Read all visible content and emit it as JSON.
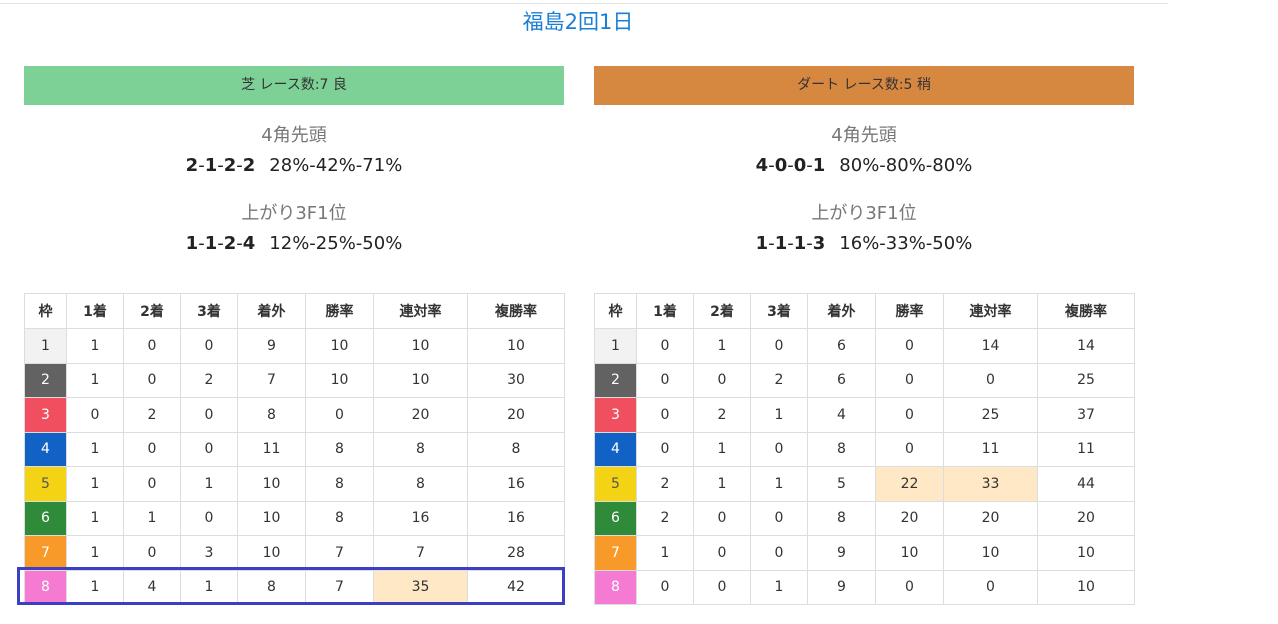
{
  "page": {
    "title": "福島2回1日"
  },
  "colors": {
    "link": "#1a7fd4",
    "turf_banner": "#7dd197",
    "dirt_banner": "#d68841",
    "highlight_cell": "#ffe8c6",
    "selection_box": "#3b3fc4",
    "waku": [
      {
        "bg": "#f2f2f2",
        "fg": "#333333"
      },
      {
        "bg": "#626262",
        "fg": "#ffffff"
      },
      {
        "bg": "#ef4f5e",
        "fg": "#ffffff"
      },
      {
        "bg": "#1262c6",
        "fg": "#ffffff"
      },
      {
        "bg": "#f4d214",
        "fg": "#555555"
      },
      {
        "bg": "#2f8a3a",
        "fg": "#ffffff"
      },
      {
        "bg": "#f89a2a",
        "fg": "#ffffff"
      },
      {
        "bg": "#f57ad2",
        "fg": "#ffffff"
      }
    ]
  },
  "headers": [
    "枠",
    "1着",
    "2着",
    "3着",
    "着外",
    "勝率",
    "連対率",
    "複勝率"
  ],
  "panels": [
    {
      "banner": "芝 レース数:7 良",
      "banner_color": "#7dd197",
      "corner_title": "4角先頭",
      "corner_record": [
        "2",
        "1",
        "2",
        "2"
      ],
      "corner_pct": "28%-42%-71%",
      "agari_title": "上がり3F1位",
      "agari_record": [
        "1",
        "1",
        "2",
        "4"
      ],
      "agari_pct": "12%-25%-50%",
      "rows": [
        [
          "1",
          "1",
          "0",
          "0",
          "9",
          "10",
          "10",
          "10"
        ],
        [
          "2",
          "1",
          "0",
          "2",
          "7",
          "10",
          "10",
          "30"
        ],
        [
          "3",
          "0",
          "2",
          "0",
          "8",
          "0",
          "20",
          "20"
        ],
        [
          "4",
          "1",
          "0",
          "0",
          "11",
          "8",
          "8",
          "8"
        ],
        [
          "5",
          "1",
          "0",
          "1",
          "10",
          "8",
          "8",
          "16"
        ],
        [
          "6",
          "1",
          "1",
          "0",
          "10",
          "8",
          "16",
          "16"
        ],
        [
          "7",
          "1",
          "0",
          "3",
          "10",
          "7",
          "7",
          "28"
        ],
        [
          "8",
          "1",
          "4",
          "1",
          "8",
          "7",
          "35",
          "42"
        ]
      ],
      "highlights": [
        [
          7,
          6
        ]
      ]
    },
    {
      "banner": "ダート レース数:5 稍",
      "banner_color": "#d68841",
      "corner_title": "4角先頭",
      "corner_record": [
        "4",
        "0",
        "0",
        "1"
      ],
      "corner_pct": "80%-80%-80%",
      "agari_title": "上がり3F1位",
      "agari_record": [
        "1",
        "1",
        "1",
        "3"
      ],
      "agari_pct": "16%-33%-50%",
      "rows": [
        [
          "1",
          "0",
          "1",
          "0",
          "6",
          "0",
          "14",
          "14"
        ],
        [
          "2",
          "0",
          "0",
          "2",
          "6",
          "0",
          "0",
          "25"
        ],
        [
          "3",
          "0",
          "2",
          "1",
          "4",
          "0",
          "25",
          "37"
        ],
        [
          "4",
          "0",
          "1",
          "0",
          "8",
          "0",
          "11",
          "11"
        ],
        [
          "5",
          "2",
          "1",
          "1",
          "5",
          "22",
          "33",
          "44"
        ],
        [
          "6",
          "2",
          "0",
          "0",
          "8",
          "20",
          "20",
          "20"
        ],
        [
          "7",
          "1",
          "0",
          "0",
          "9",
          "10",
          "10",
          "10"
        ],
        [
          "8",
          "0",
          "0",
          "1",
          "9",
          "0",
          "0",
          "10"
        ]
      ],
      "highlights": [
        [
          4,
          5
        ],
        [
          4,
          6
        ]
      ]
    }
  ]
}
